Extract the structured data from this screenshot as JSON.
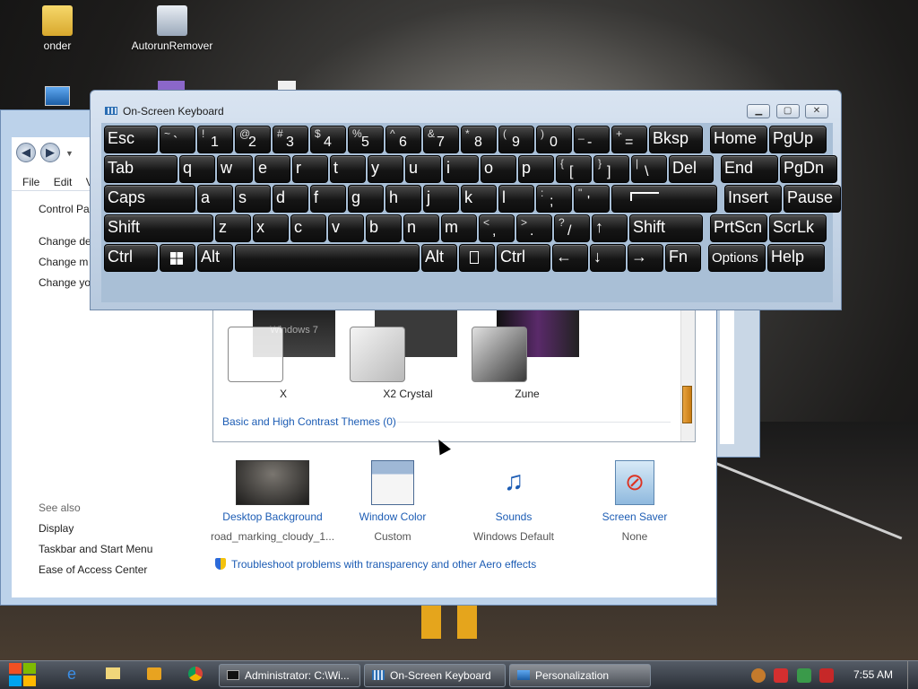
{
  "desktop": {
    "icons": [
      {
        "label": "onder",
        "icon": "folder-icon"
      },
      {
        "label": "AutorunRemover",
        "icon": "autorun-remover-icon"
      }
    ]
  },
  "personalization": {
    "menu": [
      "File",
      "Edit",
      "V"
    ],
    "sidebar": {
      "home": "Control Pa",
      "links": [
        "Change de",
        "Change m",
        "Change yo"
      ],
      "see_also_title": "See also",
      "see_also": [
        "Display",
        "Taskbar and Start Menu",
        "Ease of Access Center"
      ]
    },
    "themes": [
      {
        "name": "X",
        "thumb_text": "Windows 7"
      },
      {
        "name": "X2 Crystal",
        "thumb_text": ""
      },
      {
        "name": "Zune",
        "thumb_text": ""
      }
    ],
    "section": "Basic and High Contrast Themes (0)",
    "bottom": [
      {
        "label": "Desktop Background",
        "sub": "road_marking_cloudy_1..."
      },
      {
        "label": "Window Color",
        "sub": "Custom"
      },
      {
        "label": "Sounds",
        "sub": "Windows Default"
      },
      {
        "label": "Screen Saver",
        "sub": "None"
      }
    ],
    "troubleshoot": "Troubleshoot problems with transparency and other Aero effects"
  },
  "osk": {
    "title": "On-Screen Keyboard",
    "rows": [
      [
        {
          "t": "Esc"
        },
        {
          "a": "~",
          "b": "`"
        },
        {
          "a": "!",
          "b": "1"
        },
        {
          "a": "@",
          "b": "2"
        },
        {
          "a": "#",
          "b": "3"
        },
        {
          "a": "$",
          "b": "4"
        },
        {
          "a": "%",
          "b": "5"
        },
        {
          "a": "^",
          "b": "6"
        },
        {
          "a": "&",
          "b": "7"
        },
        {
          "a": "*",
          "b": "8"
        },
        {
          "a": "(",
          "b": "9"
        },
        {
          "a": ")",
          "b": "0"
        },
        {
          "a": "_",
          "b": "-"
        },
        {
          "a": "+",
          "b": "="
        },
        {
          "t": "Bksp"
        },
        {
          "t": "Home"
        },
        {
          "t": "PgUp"
        }
      ],
      [
        {
          "t": "Tab"
        },
        {
          "t": "q"
        },
        {
          "t": "w"
        },
        {
          "t": "e"
        },
        {
          "t": "r"
        },
        {
          "t": "t"
        },
        {
          "t": "y"
        },
        {
          "t": "u"
        },
        {
          "t": "i"
        },
        {
          "t": "o"
        },
        {
          "t": "p"
        },
        {
          "a": "{",
          "b": "["
        },
        {
          "a": "}",
          "b": "]"
        },
        {
          "a": "|",
          "b": "\\"
        },
        {
          "t": "Del"
        },
        {
          "t": "End"
        },
        {
          "t": "PgDn"
        }
      ],
      [
        {
          "t": "Caps"
        },
        {
          "t": "a"
        },
        {
          "t": "s"
        },
        {
          "t": "d"
        },
        {
          "t": "f"
        },
        {
          "t": "g"
        },
        {
          "t": "h"
        },
        {
          "t": "j"
        },
        {
          "t": "k"
        },
        {
          "t": "l"
        },
        {
          "a": ":",
          "b": ";"
        },
        {
          "a": "\"",
          "b": "'"
        },
        {
          "t": ""
        },
        {
          "t": "Insert"
        },
        {
          "t": "Pause"
        }
      ],
      [
        {
          "t": "Shift"
        },
        {
          "t": "z"
        },
        {
          "t": "x"
        },
        {
          "t": "c"
        },
        {
          "t": "v"
        },
        {
          "t": "b"
        },
        {
          "t": "n"
        },
        {
          "t": "m"
        },
        {
          "a": "<",
          "b": ","
        },
        {
          "a": ">",
          "b": "."
        },
        {
          "a": "?",
          "b": "/"
        },
        {
          "t": "↑"
        },
        {
          "t": "Shift"
        },
        {
          "t": "PrtScn"
        },
        {
          "t": "ScrLk"
        }
      ],
      [
        {
          "t": "Ctrl"
        },
        {
          "t": ""
        },
        {
          "t": "Alt"
        },
        {
          "t": ""
        },
        {
          "t": "Alt"
        },
        {
          "t": ""
        },
        {
          "t": "Ctrl"
        },
        {
          "t": "←"
        },
        {
          "t": "↓"
        },
        {
          "t": "→"
        },
        {
          "t": "Fn"
        },
        {
          "t": "Options"
        },
        {
          "t": "Help"
        }
      ]
    ]
  },
  "taskbar": {
    "tasks": [
      {
        "label": "Administrator: C:\\Wi..."
      },
      {
        "label": "On-Screen Keyboard"
      },
      {
        "label": "Personalization"
      }
    ],
    "clock": "7:55 AM"
  }
}
